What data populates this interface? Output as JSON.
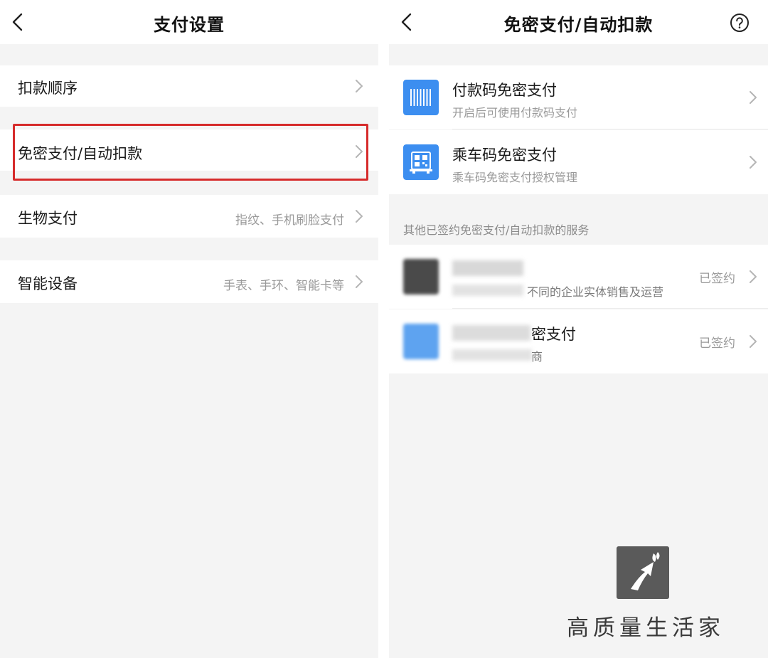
{
  "left": {
    "header": {
      "title": "支付设置"
    },
    "rows": [
      {
        "label": "扣款顺序",
        "value": ""
      },
      {
        "label": "免密支付/自动扣款",
        "value": ""
      },
      {
        "label": "生物支付",
        "value": "指纹、手机刷脸支付"
      },
      {
        "label": "智能设备",
        "value": "手表、手环、智能卡等"
      }
    ]
  },
  "right": {
    "header": {
      "title": "免密支付/自动扣款"
    },
    "services": [
      {
        "title": "付款码免密支付",
        "subtitle": "开启后可使用付款码支付",
        "icon": "barcode-icon"
      },
      {
        "title": "乘车码免密支付",
        "subtitle": "乘车码免密支付授权管理",
        "icon": "bus-qr-icon"
      }
    ],
    "section_caption": "其他已签约免密支付/自动扣款的服务",
    "signed": [
      {
        "title_visible": "",
        "subtitle_visible": "不同的企业实体销售及运营",
        "status": "已签约",
        "icon": "apple-app-icon"
      },
      {
        "title_visible": "密支付",
        "subtitle_visible": "商",
        "status": "已签约",
        "icon": "merchant-app-icon"
      }
    ]
  },
  "watermark": {
    "text": "高质量生活家"
  },
  "colors": {
    "accent_blue": "#3c8ef0",
    "highlight_red": "#d62b2b",
    "background": "#f4f4f4"
  }
}
